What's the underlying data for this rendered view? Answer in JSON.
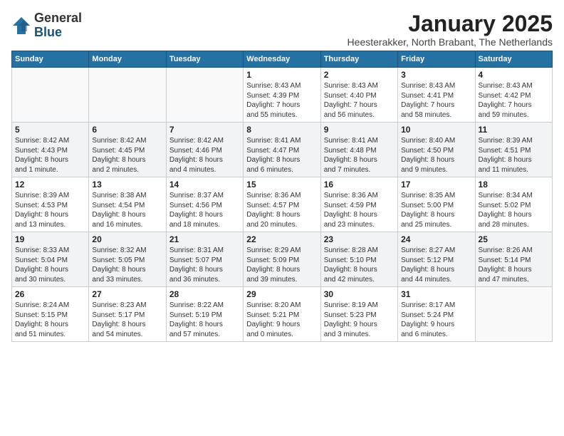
{
  "logo": {
    "general": "General",
    "blue": "Blue"
  },
  "header": {
    "month": "January 2025",
    "location": "Heesterakker, North Brabant, The Netherlands"
  },
  "weekdays": [
    "Sunday",
    "Monday",
    "Tuesday",
    "Wednesday",
    "Thursday",
    "Friday",
    "Saturday"
  ],
  "weeks": [
    [
      {
        "day": "",
        "info": ""
      },
      {
        "day": "",
        "info": ""
      },
      {
        "day": "",
        "info": ""
      },
      {
        "day": "1",
        "info": "Sunrise: 8:43 AM\nSunset: 4:39 PM\nDaylight: 7 hours\nand 55 minutes."
      },
      {
        "day": "2",
        "info": "Sunrise: 8:43 AM\nSunset: 4:40 PM\nDaylight: 7 hours\nand 56 minutes."
      },
      {
        "day": "3",
        "info": "Sunrise: 8:43 AM\nSunset: 4:41 PM\nDaylight: 7 hours\nand 58 minutes."
      },
      {
        "day": "4",
        "info": "Sunrise: 8:43 AM\nSunset: 4:42 PM\nDaylight: 7 hours\nand 59 minutes."
      }
    ],
    [
      {
        "day": "5",
        "info": "Sunrise: 8:42 AM\nSunset: 4:43 PM\nDaylight: 8 hours\nand 1 minute."
      },
      {
        "day": "6",
        "info": "Sunrise: 8:42 AM\nSunset: 4:45 PM\nDaylight: 8 hours\nand 2 minutes."
      },
      {
        "day": "7",
        "info": "Sunrise: 8:42 AM\nSunset: 4:46 PM\nDaylight: 8 hours\nand 4 minutes."
      },
      {
        "day": "8",
        "info": "Sunrise: 8:41 AM\nSunset: 4:47 PM\nDaylight: 8 hours\nand 6 minutes."
      },
      {
        "day": "9",
        "info": "Sunrise: 8:41 AM\nSunset: 4:48 PM\nDaylight: 8 hours\nand 7 minutes."
      },
      {
        "day": "10",
        "info": "Sunrise: 8:40 AM\nSunset: 4:50 PM\nDaylight: 8 hours\nand 9 minutes."
      },
      {
        "day": "11",
        "info": "Sunrise: 8:39 AM\nSunset: 4:51 PM\nDaylight: 8 hours\nand 11 minutes."
      }
    ],
    [
      {
        "day": "12",
        "info": "Sunrise: 8:39 AM\nSunset: 4:53 PM\nDaylight: 8 hours\nand 13 minutes."
      },
      {
        "day": "13",
        "info": "Sunrise: 8:38 AM\nSunset: 4:54 PM\nDaylight: 8 hours\nand 16 minutes."
      },
      {
        "day": "14",
        "info": "Sunrise: 8:37 AM\nSunset: 4:56 PM\nDaylight: 8 hours\nand 18 minutes."
      },
      {
        "day": "15",
        "info": "Sunrise: 8:36 AM\nSunset: 4:57 PM\nDaylight: 8 hours\nand 20 minutes."
      },
      {
        "day": "16",
        "info": "Sunrise: 8:36 AM\nSunset: 4:59 PM\nDaylight: 8 hours\nand 23 minutes."
      },
      {
        "day": "17",
        "info": "Sunrise: 8:35 AM\nSunset: 5:00 PM\nDaylight: 8 hours\nand 25 minutes."
      },
      {
        "day": "18",
        "info": "Sunrise: 8:34 AM\nSunset: 5:02 PM\nDaylight: 8 hours\nand 28 minutes."
      }
    ],
    [
      {
        "day": "19",
        "info": "Sunrise: 8:33 AM\nSunset: 5:04 PM\nDaylight: 8 hours\nand 30 minutes."
      },
      {
        "day": "20",
        "info": "Sunrise: 8:32 AM\nSunset: 5:05 PM\nDaylight: 8 hours\nand 33 minutes."
      },
      {
        "day": "21",
        "info": "Sunrise: 8:31 AM\nSunset: 5:07 PM\nDaylight: 8 hours\nand 36 minutes."
      },
      {
        "day": "22",
        "info": "Sunrise: 8:29 AM\nSunset: 5:09 PM\nDaylight: 8 hours\nand 39 minutes."
      },
      {
        "day": "23",
        "info": "Sunrise: 8:28 AM\nSunset: 5:10 PM\nDaylight: 8 hours\nand 42 minutes."
      },
      {
        "day": "24",
        "info": "Sunrise: 8:27 AM\nSunset: 5:12 PM\nDaylight: 8 hours\nand 44 minutes."
      },
      {
        "day": "25",
        "info": "Sunrise: 8:26 AM\nSunset: 5:14 PM\nDaylight: 8 hours\nand 47 minutes."
      }
    ],
    [
      {
        "day": "26",
        "info": "Sunrise: 8:24 AM\nSunset: 5:15 PM\nDaylight: 8 hours\nand 51 minutes."
      },
      {
        "day": "27",
        "info": "Sunrise: 8:23 AM\nSunset: 5:17 PM\nDaylight: 8 hours\nand 54 minutes."
      },
      {
        "day": "28",
        "info": "Sunrise: 8:22 AM\nSunset: 5:19 PM\nDaylight: 8 hours\nand 57 minutes."
      },
      {
        "day": "29",
        "info": "Sunrise: 8:20 AM\nSunset: 5:21 PM\nDaylight: 9 hours\nand 0 minutes."
      },
      {
        "day": "30",
        "info": "Sunrise: 8:19 AM\nSunset: 5:23 PM\nDaylight: 9 hours\nand 3 minutes."
      },
      {
        "day": "31",
        "info": "Sunrise: 8:17 AM\nSunset: 5:24 PM\nDaylight: 9 hours\nand 6 minutes."
      },
      {
        "day": "",
        "info": ""
      }
    ]
  ]
}
